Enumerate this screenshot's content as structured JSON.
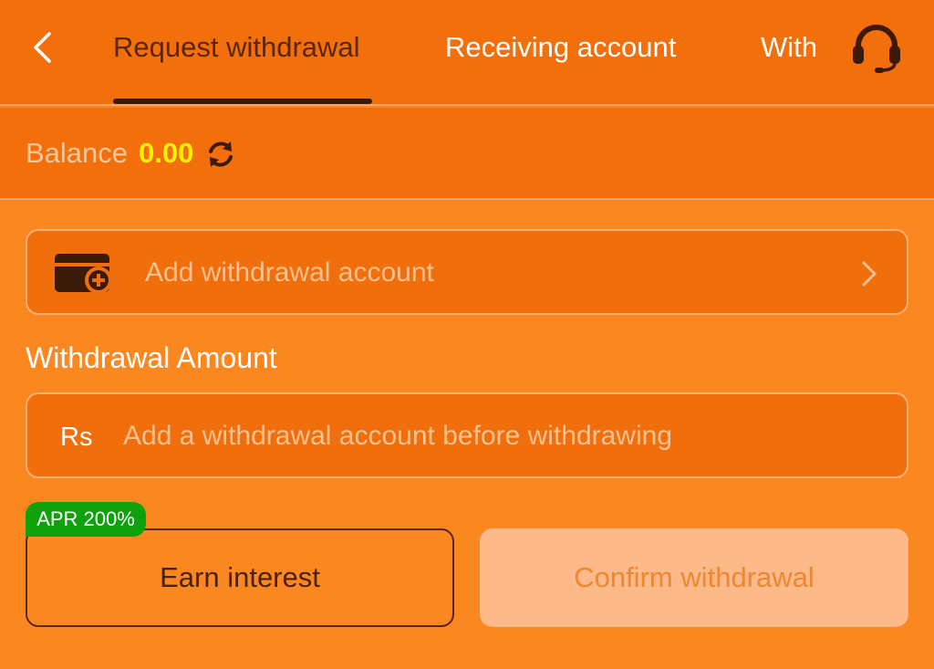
{
  "header": {
    "tabs": [
      {
        "label": "Request withdrawal",
        "active": true
      },
      {
        "label": "Receiving account",
        "active": false
      },
      {
        "label": "With",
        "active": false
      }
    ],
    "back_icon": "chevron-left-icon",
    "support_icon": "headset-icon"
  },
  "balance": {
    "label": "Balance",
    "value": "0.00",
    "refresh_icon": "refresh-icon"
  },
  "account": {
    "label": "Add withdrawal account",
    "icon": "wallet-add-icon",
    "chevron_icon": "chevron-right-icon"
  },
  "amount": {
    "title": "Withdrawal Amount",
    "currency": "Rs",
    "placeholder": "Add a withdrawal account before withdrawing",
    "value": ""
  },
  "actions": {
    "earn_label": "Earn interest",
    "apr_badge": "APR 200%",
    "confirm_label": "Confirm withdrawal"
  },
  "colors": {
    "header_bg": "#f26f0c",
    "page_bg": "#fb8721",
    "balance_value": "#fff200",
    "apr_badge_bg": "#0ea10c",
    "confirm_disabled_bg": "#fcb98a",
    "active_tab_text": "#5a2608"
  }
}
